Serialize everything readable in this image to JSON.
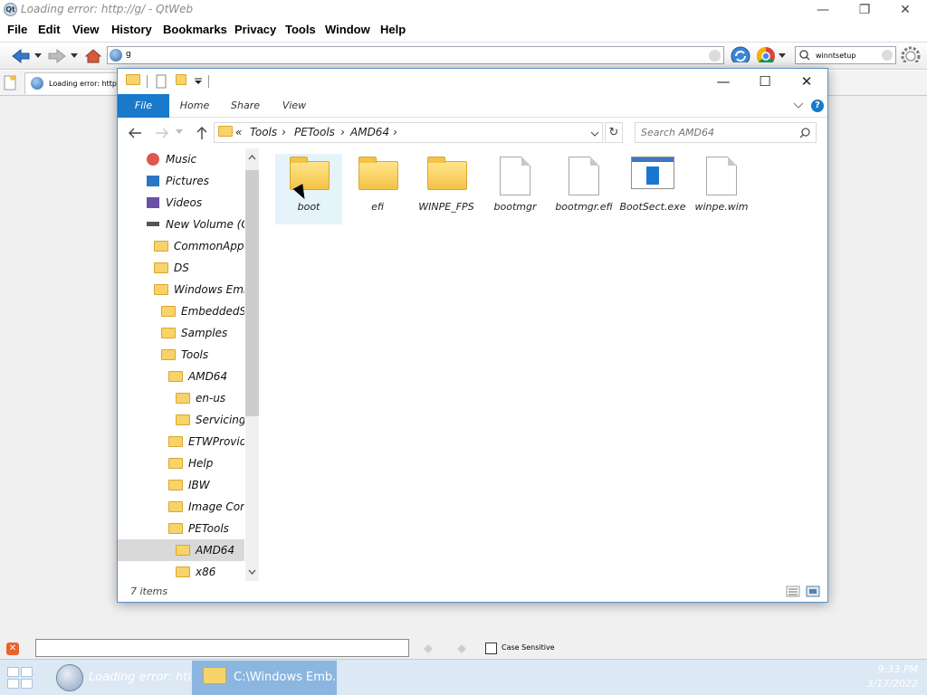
{
  "qtweb": {
    "title": "Loading error: http://g/ - QtWeb",
    "app_icon": "Qt",
    "menu": [
      "File",
      "Edit",
      "View",
      "History",
      "Bookmarks",
      "Privacy",
      "Tools",
      "Window",
      "Help"
    ],
    "url": "g",
    "search_value": "winntsetup",
    "tab_label": "Loading error: http://g/",
    "find_label": "Case Sensitive",
    "find_value": ""
  },
  "explorer": {
    "ribbon_tabs": [
      "File",
      "Home",
      "Share",
      "View"
    ],
    "breadcrumb": [
      "«",
      "Tools",
      "PETools",
      "AMD64"
    ],
    "search_placeholder": "Search AMD64",
    "nav_items": [
      {
        "label": "Music",
        "icon": "music-icon"
      },
      {
        "label": "Pictures",
        "icon": "pictures-icon"
      },
      {
        "label": "Videos",
        "icon": "videos-icon"
      },
      {
        "label": "New Volume (C:)",
        "icon": "drive-icon"
      },
      {
        "label": "CommonAppData",
        "icon": "folder-icon"
      },
      {
        "label": "DS",
        "icon": "folder-icon"
      },
      {
        "label": "Windows Embedded",
        "icon": "folder-icon"
      },
      {
        "label": "EmbeddedSDK",
        "icon": "folder-icon"
      },
      {
        "label": "Samples",
        "icon": "folder-icon"
      },
      {
        "label": "Tools",
        "icon": "folder-icon"
      },
      {
        "label": "AMD64",
        "icon": "folder-icon"
      },
      {
        "label": "en-us",
        "icon": "folder-icon"
      },
      {
        "label": "Servicing",
        "icon": "folder-icon"
      },
      {
        "label": "ETWProviders",
        "icon": "folder-icon"
      },
      {
        "label": "Help",
        "icon": "folder-icon"
      },
      {
        "label": "IBW",
        "icon": "folder-icon"
      },
      {
        "label": "Image Configuration",
        "icon": "folder-icon"
      },
      {
        "label": "PETools",
        "icon": "folder-icon"
      },
      {
        "label": "AMD64",
        "icon": "folder-icon"
      },
      {
        "label": "x86",
        "icon": "folder-icon"
      }
    ],
    "files": [
      {
        "name": "boot",
        "type": "folder"
      },
      {
        "name": "efi",
        "type": "folder"
      },
      {
        "name": "WINPE_FPS",
        "type": "folder"
      },
      {
        "name": "bootmgr",
        "type": "file"
      },
      {
        "name": "bootmgr.efi",
        "type": "file"
      },
      {
        "name": "BootSect.exe",
        "type": "exe"
      },
      {
        "name": "winpe.wim",
        "type": "file"
      }
    ],
    "status": "7 items"
  },
  "taskbar": {
    "tasks": [
      "Loading error: htt...",
      "C:\\Windows Emb..."
    ],
    "time": "9:33 PM",
    "date": "3/17/2022"
  },
  "colors": {
    "accent": "#1979ca",
    "folder": "#f4c245",
    "taskbar": "#dce8f4"
  }
}
